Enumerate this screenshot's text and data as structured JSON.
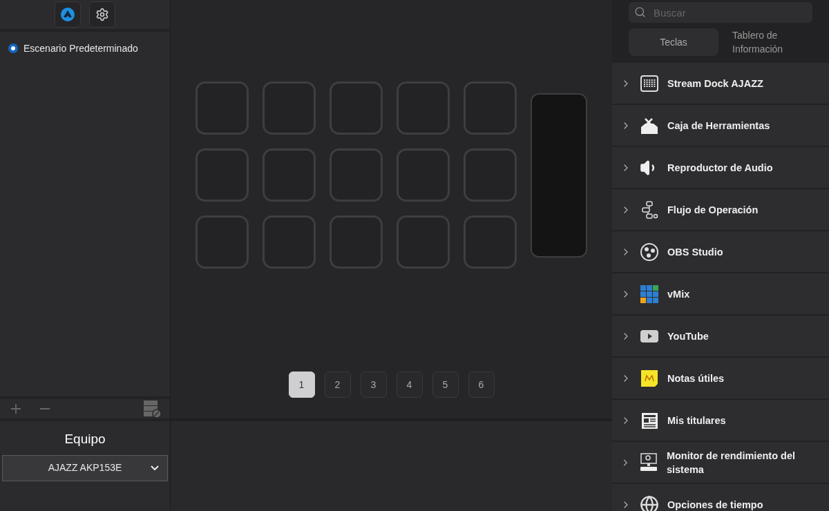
{
  "toolbar": {
    "buttons": [
      {
        "kind": "logo"
      },
      {
        "kind": "settings"
      }
    ]
  },
  "scenes": [
    {
      "label": "Escenario Predeterminado",
      "selected": true
    }
  ],
  "device": {
    "title": "Equipo",
    "value": "AJAZZ AKP153E"
  },
  "pages": [
    {
      "label": "1",
      "selected": true
    },
    {
      "label": "2",
      "selected": false
    },
    {
      "label": "3",
      "selected": false
    },
    {
      "label": "4",
      "selected": false
    },
    {
      "label": "5",
      "selected": false
    },
    {
      "label": "6",
      "selected": false
    }
  ],
  "search": {
    "placeholder": "Buscar"
  },
  "tabs": [
    {
      "label": "Teclas",
      "selected": true
    },
    {
      "label": "Tablero de Información",
      "selected": false
    }
  ],
  "plugins": [
    {
      "label": "Stream Dock AJAZZ",
      "expanded": false
    },
    {
      "label": "Caja de Herramientas",
      "expanded": false
    },
    {
      "label": "Reproductor de Audio",
      "expanded": false
    },
    {
      "label": "Flujo de Operación",
      "expanded": false
    },
    {
      "label": "OBS Studio",
      "expanded": false
    },
    {
      "label": "vMix",
      "expanded": false
    },
    {
      "label": "YouTube",
      "expanded": false
    },
    {
      "label": "Notas útiles",
      "expanded": false
    },
    {
      "label": "Mis titulares",
      "expanded": false
    },
    {
      "label": "Monitor de rendimiento del sistema",
      "expanded": false
    },
    {
      "label": "Opciones de tiempo",
      "expanded": false
    }
  ]
}
